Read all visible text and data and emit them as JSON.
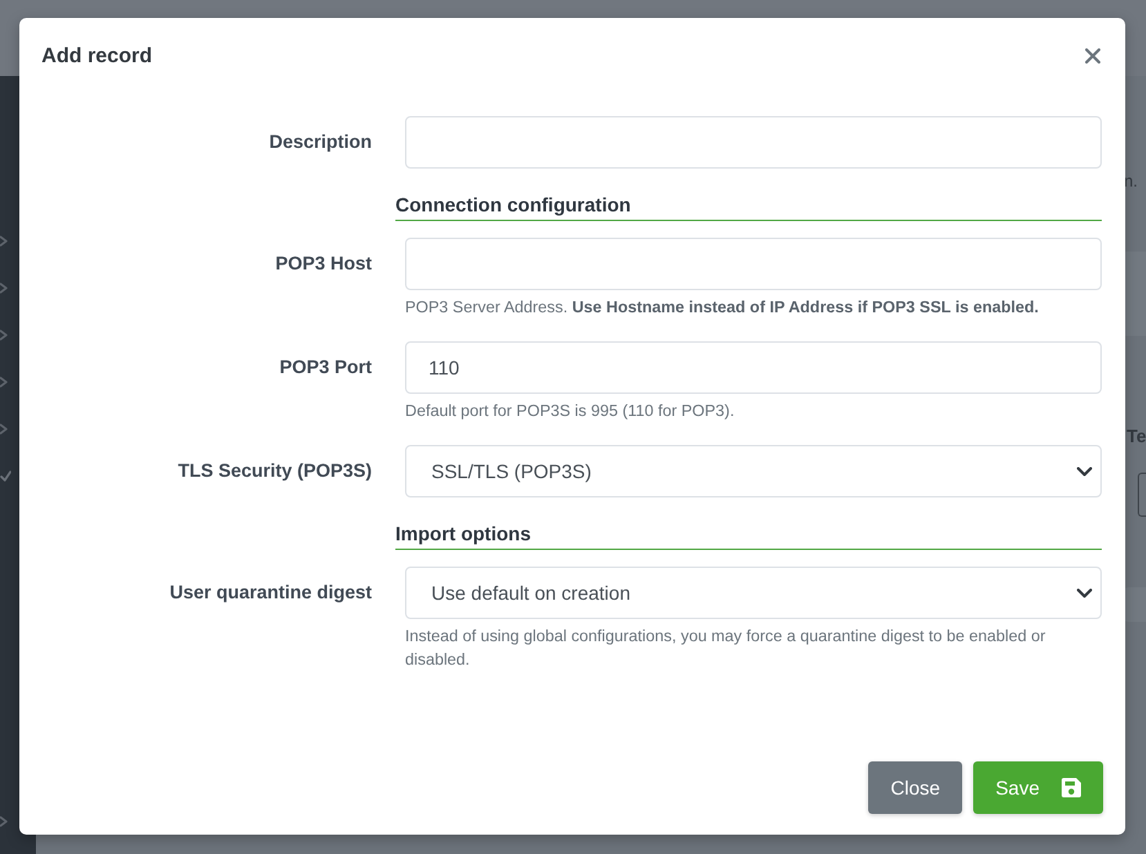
{
  "backdrop": {
    "texts": [
      "n.",
      "Te"
    ]
  },
  "modal": {
    "title": "Add record"
  },
  "form": [
    {
      "kind": "input",
      "label": "Description"
    },
    {
      "kind": "heading",
      "text": "Connection configuration"
    },
    {
      "kind": "input",
      "label": "POP3 Host",
      "help": "POP3 Server Address. **Use Hostname instead of IP Address if POP3 SSL is enabled.**"
    },
    {
      "kind": "input",
      "label": "POP3 Port",
      "value": "110",
      "help": "Default port for POP3S is 995 (110 for POP3)."
    },
    {
      "kind": "select",
      "label": "TLS Security (POP3S)",
      "value": "SSL/TLS (POP3S)"
    },
    {
      "kind": "heading",
      "text": "Import options"
    },
    {
      "kind": "select",
      "label": "User quarantine digest",
      "value": "Use default on creation",
      "help": "Instead of using global configurations, you may force a quarantine digest to be enabled or disabled."
    }
  ],
  "buttons": [
    {
      "label": "Close",
      "kind": "secondary"
    },
    {
      "label": "Save",
      "kind": "primary"
    }
  ]
}
